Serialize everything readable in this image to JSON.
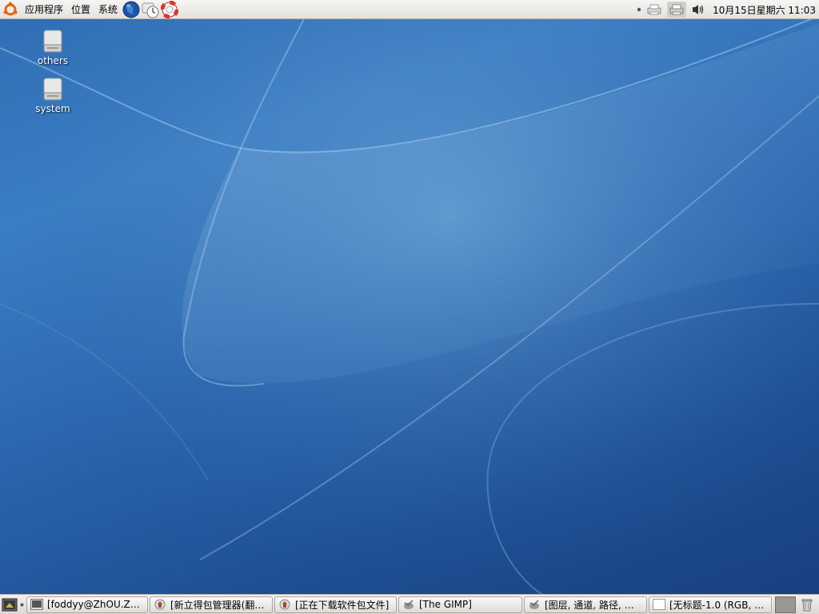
{
  "top_panel": {
    "menus": [
      "应用程序",
      "位置",
      "系统"
    ],
    "launchers": [
      "globe-icon",
      "clock-icon",
      "lifebuoy-help-icon"
    ],
    "clock": "10月15日星期六 11:03"
  },
  "desktop_icons": [
    {
      "label": "others",
      "icon": "drive-icon"
    },
    {
      "label": "system",
      "icon": "drive-icon"
    }
  ],
  "taskbar": {
    "tasks": [
      {
        "label": "[foddyy@ZhOU.Z…",
        "icon": "terminal-icon"
      },
      {
        "label": "[新立得包管理器(翻…",
        "icon": "package-manager-icon"
      },
      {
        "label": "[正在下载软件包文件]",
        "icon": "package-manager-icon"
      },
      {
        "label": "[The GIMP]",
        "icon": "gimp-icon"
      },
      {
        "label": "[图层, 通道, 路径, …",
        "icon": "gimp-icon"
      },
      {
        "label": "[无标题-1.0 (RGB, …",
        "icon": "image-window-icon"
      }
    ]
  },
  "colors": {
    "desktop_base": "#2b66ae",
    "panel_bg": "#e8e6e2"
  }
}
